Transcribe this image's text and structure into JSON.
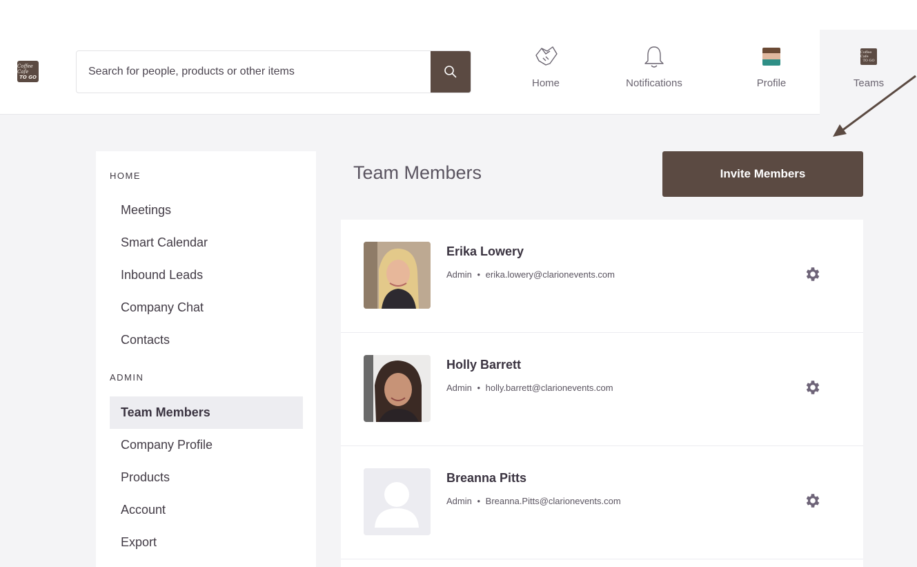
{
  "app": {
    "logo_line1": "Coffee Cafe",
    "logo_line2": "TO GO"
  },
  "search": {
    "placeholder": "Search for people, products or other items"
  },
  "nav": {
    "items": [
      {
        "label": "Home",
        "icon": "handshake-icon"
      },
      {
        "label": "Notifications",
        "icon": "bell-icon"
      },
      {
        "label": "Profile",
        "icon": "avatar"
      },
      {
        "label": "Teams",
        "icon": "team-logo"
      }
    ],
    "active": "Teams"
  },
  "sidebar": {
    "sections": [
      {
        "heading": "HOME",
        "items": [
          "Meetings",
          "Smart Calendar",
          "Inbound Leads",
          "Company Chat",
          "Contacts"
        ]
      },
      {
        "heading": "ADMIN",
        "items": [
          "Team Members",
          "Company Profile",
          "Products",
          "Account",
          "Export"
        ]
      }
    ],
    "active_item": "Team Members"
  },
  "main": {
    "title": "Team Members",
    "invite_label": "Invite Members",
    "members": [
      {
        "name": "Erika Lowery",
        "role": "Admin",
        "email": "erika.lowery@clarionevents.com",
        "separator": "•"
      },
      {
        "name": "Holly Barrett",
        "role": "Admin",
        "email": "holly.barrett@clarionevents.com",
        "separator": "•"
      },
      {
        "name": "Breanna Pitts",
        "role": "Admin",
        "email": "Breanna.Pitts@clarionevents.com",
        "separator": "•"
      }
    ]
  },
  "colors": {
    "brand": "#5b4a42",
    "background": "#f4f4f6",
    "gear": "#6e6478",
    "arrow": "#5b4a42"
  }
}
